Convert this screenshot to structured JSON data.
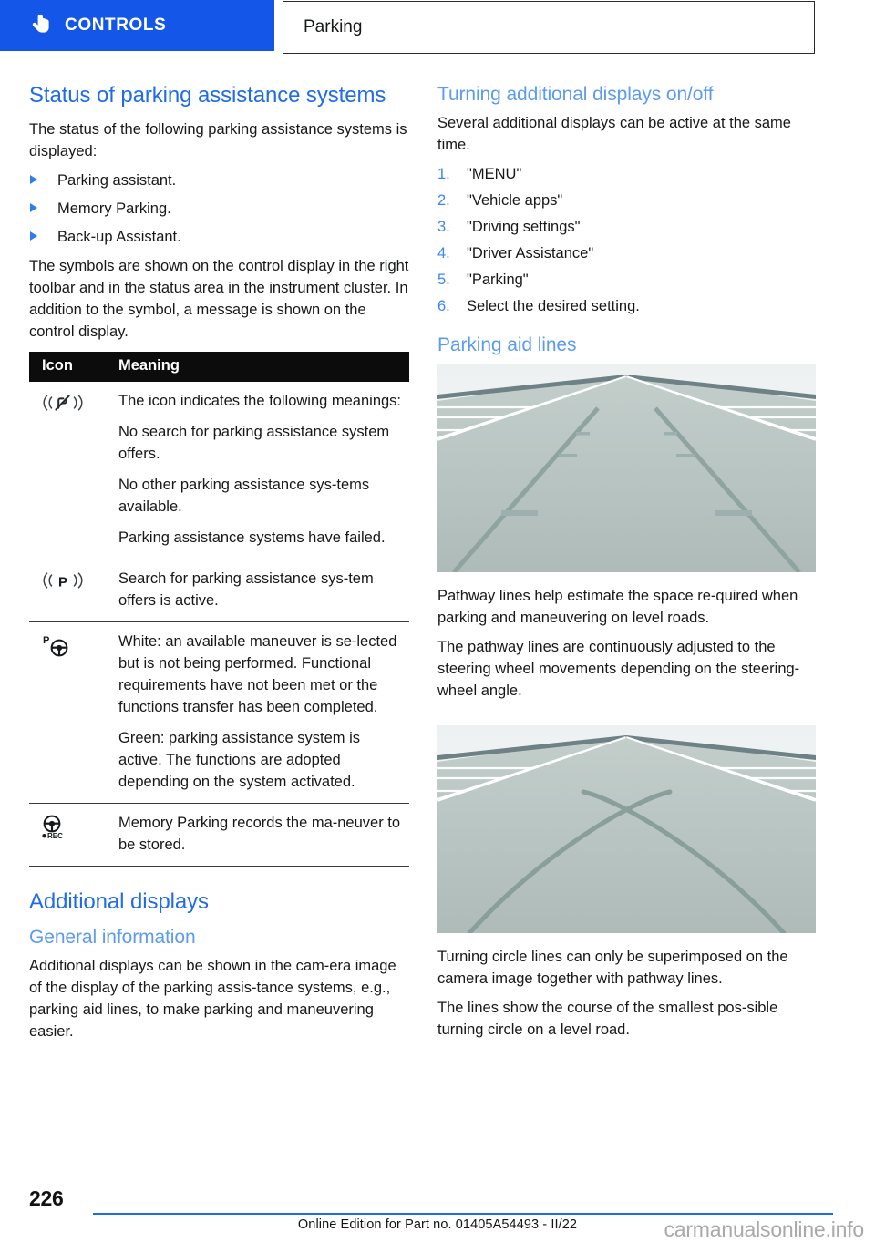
{
  "header": {
    "controls_tab": "CONTROLS",
    "hand_icon": "hand-pointing-icon",
    "section_tab": "Parking"
  },
  "left_column": {
    "heading": "Status of parking assistance systems",
    "intro": "The status of the following parking assistance systems is displayed:",
    "bullets": [
      "Parking assistant.",
      "Memory Parking.",
      "Back-up Assistant."
    ],
    "after_bullets": "The symbols are shown on the control display in the right toolbar and in the status area in the instrument cluster. In addition to the symbol, a message is shown on the control display.",
    "table": {
      "columns": [
        "Icon",
        "Meaning"
      ],
      "rows": [
        {
          "icon_name": "no-parking-sensor-icon",
          "paragraphs": [
            "The icon indicates the following meanings:",
            "No search for parking assistance system offers.",
            "No other parking assistance sys‑tems available.",
            "Parking assistance systems have failed."
          ]
        },
        {
          "icon_name": "parking-sensor-search-icon",
          "paragraphs": [
            "Search for parking assistance sys‑tem offers is active."
          ]
        },
        {
          "icon_name": "parking-steering-wheel-icon",
          "paragraphs": [
            "White: an available maneuver is se‑lected but is not being performed. Functional requirements have not been met or the functions transfer has been completed.",
            "Green: parking assistance system is active. The functions are adopted depending on the system activated."
          ]
        },
        {
          "icon_name": "memory-parking-record-icon",
          "paragraphs": [
            "Memory Parking records the ma‑neuver to be stored."
          ]
        }
      ]
    },
    "additional_displays_heading": "Additional displays",
    "general_information_heading": "General information",
    "general_information_body": "Additional displays can be shown in the cam‑era image of the display of the parking assis‑tance systems, e.g., parking aid lines, to make parking and maneuvering easier."
  },
  "right_column": {
    "turning_heading": "Turning additional displays on/off",
    "turning_intro": "Several additional displays can be active at the same time.",
    "steps": [
      {
        "number": "1.",
        "text": "\"MENU\""
      },
      {
        "number": "2.",
        "text": "\"Vehicle apps\""
      },
      {
        "number": "3.",
        "text": "\"Driving settings\""
      },
      {
        "number": "4.",
        "text": "\"Driver Assistance\""
      },
      {
        "number": "5.",
        "text": "\"Parking\""
      },
      {
        "number": "6.",
        "text": "Select the desired setting."
      }
    ],
    "parking_aid_lines_heading": "Parking aid lines",
    "figure1_name": "pathway-lines-road-illustration",
    "figure1_paragraphs": [
      "Pathway lines help estimate the space re‑quired when parking and maneuvering on level roads.",
      "The pathway lines are continuously adjusted to the steering wheel movements depending on the steering-wheel angle."
    ],
    "figure2_name": "turning-circle-lines-road-illustration",
    "figure2_paragraphs": [
      "Turning circle lines can only be superimposed on the camera image together with pathway lines.",
      "The lines show the course of the smallest pos‑sible turning circle on a level road."
    ]
  },
  "footer": {
    "page_number": "226",
    "edition_note": "Online Edition for Part no. 01405A54493 - II/22",
    "watermark": "carmanualsonline.info"
  },
  "colors": {
    "brand_blue": "#1356e8",
    "heading_blue": "#1f6bea",
    "subheading_blue": "#5b9bf0",
    "table_header_bg": "#0c0c0c",
    "road_gray": "#b6c3c0",
    "text": "#17181a"
  }
}
